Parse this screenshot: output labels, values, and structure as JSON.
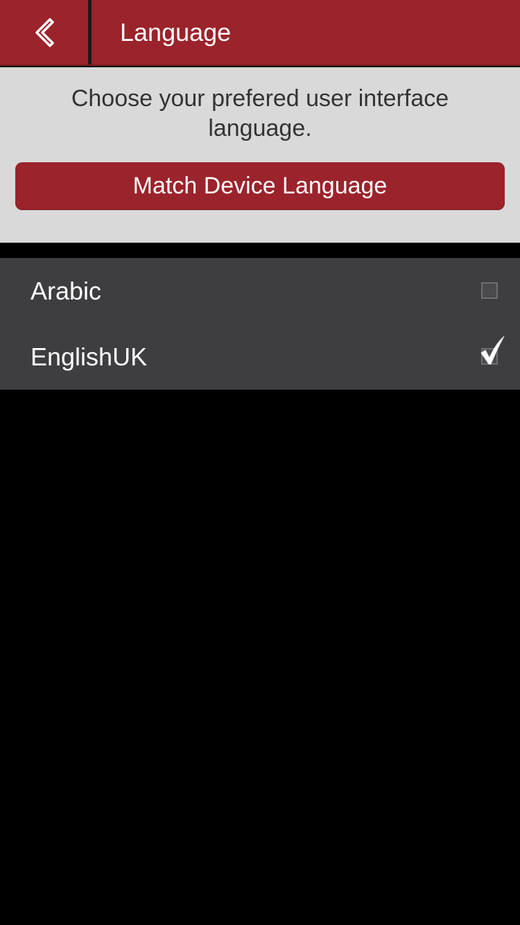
{
  "header": {
    "title": "Language",
    "back_icon": "chevron-left-icon"
  },
  "intro": {
    "description": "Choose your prefered user interface language.",
    "match_button_label": "Match Device Language"
  },
  "languages": [
    {
      "label": "Arabic",
      "checked": false
    },
    {
      "label": "EnglishUK",
      "checked": true
    }
  ],
  "colors": {
    "brand_red": "#9b232b",
    "panel_gray": "#d9d9da",
    "list_bg": "#3e3d40",
    "background": "#000000"
  }
}
